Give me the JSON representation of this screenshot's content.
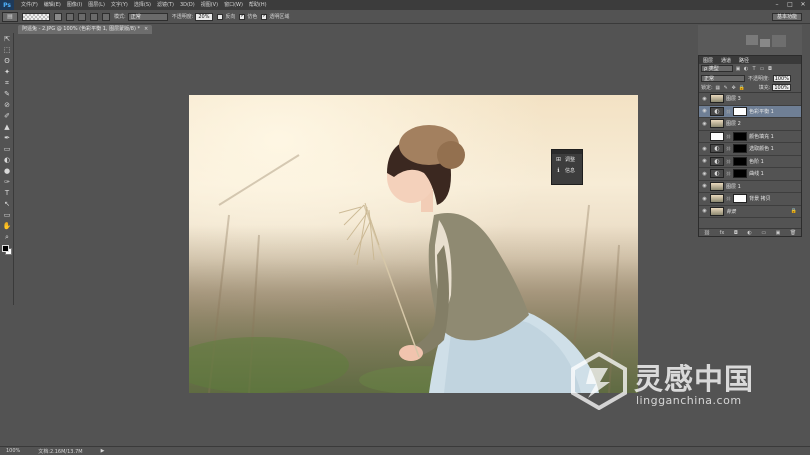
{
  "app": {
    "logo": "Ps"
  },
  "menu": [
    "文件(F)",
    "编辑(E)",
    "图像(I)",
    "图层(L)",
    "文字(Y)",
    "选择(S)",
    "滤镜(T)",
    "3D(D)",
    "视图(V)",
    "窗口(W)",
    "帮助(H)"
  ],
  "window_controls": {
    "minimize": "–",
    "maximize": "□",
    "close": "✕"
  },
  "options": {
    "mode_label": "模式:",
    "mode_value": "正常",
    "opacity_label": "不透明度:",
    "opacity_value": "20%",
    "reverse_label": "反向",
    "dither_label": "仿色",
    "transparency_label": "透明区域",
    "workspace": "基本功能"
  },
  "document_tab": {
    "title": "阿遥兔 - 2.JPG @ 100% (色彩平衡 1, 图层蒙版/8) *",
    "close": "×"
  },
  "tools": [
    "⇱",
    "⬚",
    "ʘ",
    "✦",
    "⌗",
    "✎",
    "⊘",
    "✐",
    "▲",
    "✒",
    "▭",
    "◐",
    "●",
    "✑",
    "T",
    "↖",
    "▭",
    "✋",
    "⌕"
  ],
  "mini_panel": {
    "items": [
      {
        "icon": "adjustments-icon",
        "glyph": "⊞",
        "label": "调整"
      },
      {
        "icon": "info-icon",
        "glyph": "ℹ",
        "label": "信息"
      }
    ]
  },
  "layers_panel": {
    "tabs": [
      "图层",
      "通道",
      "路径"
    ],
    "filter_label": "ρ 类型",
    "blend_mode": "正常",
    "opacity_label": "不透明度:",
    "opacity_value": "100%",
    "lock_label": "锁定:",
    "fill_label": "填充:",
    "fill_value": "100%",
    "layers": [
      {
        "name": "图层 3",
        "thumb": "photo",
        "mask": null,
        "selected": false,
        "visible": true
      },
      {
        "name": "色彩平衡 1",
        "thumb": "adjust",
        "mask": "white",
        "selected": true,
        "visible": true
      },
      {
        "name": "图层 2",
        "thumb": "photo",
        "mask": null,
        "selected": false,
        "visible": true
      },
      {
        "name": "颜色填充 1",
        "thumb": "fill-white",
        "mask": "black",
        "selected": false,
        "visible": false
      },
      {
        "name": "选取颜色 1",
        "thumb": "adjust",
        "mask": "black",
        "selected": false,
        "visible": true
      },
      {
        "name": "色阶 1",
        "thumb": "adjust",
        "mask": "black",
        "selected": false,
        "visible": true
      },
      {
        "name": "曲线 1",
        "thumb": "adjust",
        "mask": "black",
        "selected": false,
        "visible": true
      },
      {
        "name": "图层 1",
        "thumb": "photo",
        "mask": null,
        "selected": false,
        "visible": true
      },
      {
        "name": "背景 拷贝",
        "thumb": "photo",
        "mask": "white",
        "selected": false,
        "visible": true
      },
      {
        "name": "背景",
        "thumb": "photo",
        "mask": null,
        "selected": false,
        "visible": true,
        "locked": true
      }
    ],
    "footer_icons": [
      "⛓",
      "fx",
      "◘",
      "◐",
      "▭",
      "▣",
      "🗑"
    ]
  },
  "status": {
    "zoom": "100%",
    "doc": "文档:2.16M/13.7M",
    "arrow": "▶"
  },
  "watermark": {
    "cn": "灵感中国",
    "en": "lingganchina.com"
  },
  "colors": {
    "accent_selected": "#6f7f95",
    "menubar": "#3c3c3c",
    "workspace": "#535353"
  }
}
